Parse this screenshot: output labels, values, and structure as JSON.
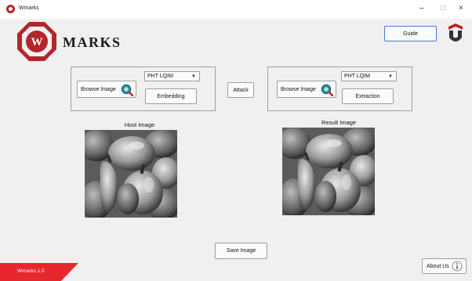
{
  "window": {
    "title": "Wmarks",
    "minimize": "–",
    "maximize": "□",
    "close": "×"
  },
  "brand": {
    "logo_letter": "W",
    "name": "MARKS"
  },
  "header": {
    "guide_label": "Guide"
  },
  "embed_panel": {
    "browse_label": "Browse Image",
    "method_selected": "PHT LQIM",
    "action_label": "Embedding"
  },
  "attack": {
    "label": "Attack"
  },
  "extract_panel": {
    "browse_label": "Browse Image",
    "method_selected": "PHT LQIM",
    "action_label": "Extraction"
  },
  "host": {
    "caption": "Host Image"
  },
  "result": {
    "caption": "Result Image"
  },
  "footer": {
    "save_label": "Save Image",
    "about_label": "About Us",
    "version": "Wmarks 1.0"
  },
  "colors": {
    "brand_red": "#b3262a",
    "accent_blue": "#3d7edb",
    "corner_red": "#e8262e",
    "background": "#f0f0f0"
  }
}
